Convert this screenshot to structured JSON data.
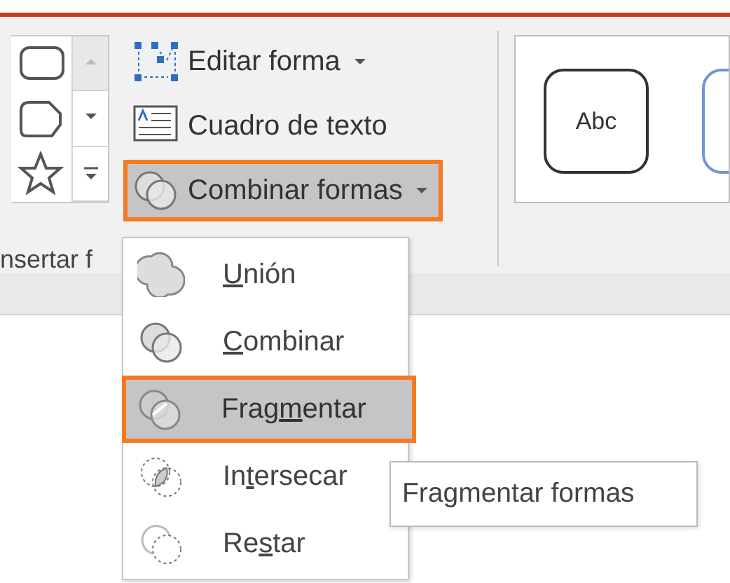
{
  "ribbon": {
    "shape_gallery": {
      "shapes": [
        {
          "kind": "rounded-rectangle"
        },
        {
          "kind": "snip"
        },
        {
          "kind": "star"
        }
      ]
    },
    "group_label": "nsertar f",
    "buttons": [
      {
        "kind": "edit-points",
        "label": "Editar forma",
        "dropdown": true,
        "selected": false
      },
      {
        "kind": "text-box",
        "label": "Cuadro de texto",
        "dropdown": false,
        "selected": false
      },
      {
        "kind": "combine",
        "label": "Combinar formas",
        "dropdown": true,
        "selected": true
      }
    ],
    "style_gallery": [
      {
        "text": "Abc",
        "color": "#333333"
      },
      {
        "color": "#6f95d8"
      }
    ]
  },
  "menu": {
    "items": [
      {
        "kind": "union",
        "label": {
          "key": "U",
          "after": "nión"
        },
        "selected": false
      },
      {
        "kind": "combine",
        "label": {
          "key": "C",
          "after": "ombinar"
        },
        "selected": false
      },
      {
        "kind": "fragment",
        "label": {
          "before": "Frag",
          "key": "m",
          "after": "entar"
        },
        "selected": true
      },
      {
        "kind": "intersect",
        "label": {
          "before": "In",
          "key": "t",
          "after": "ersecar"
        },
        "selected": false
      },
      {
        "kind": "subtract",
        "label": {
          "before": "Re",
          "key": "s",
          "after": "tar"
        },
        "selected": false
      }
    ]
  },
  "tooltip": {
    "text": "Fragmentar formas"
  }
}
